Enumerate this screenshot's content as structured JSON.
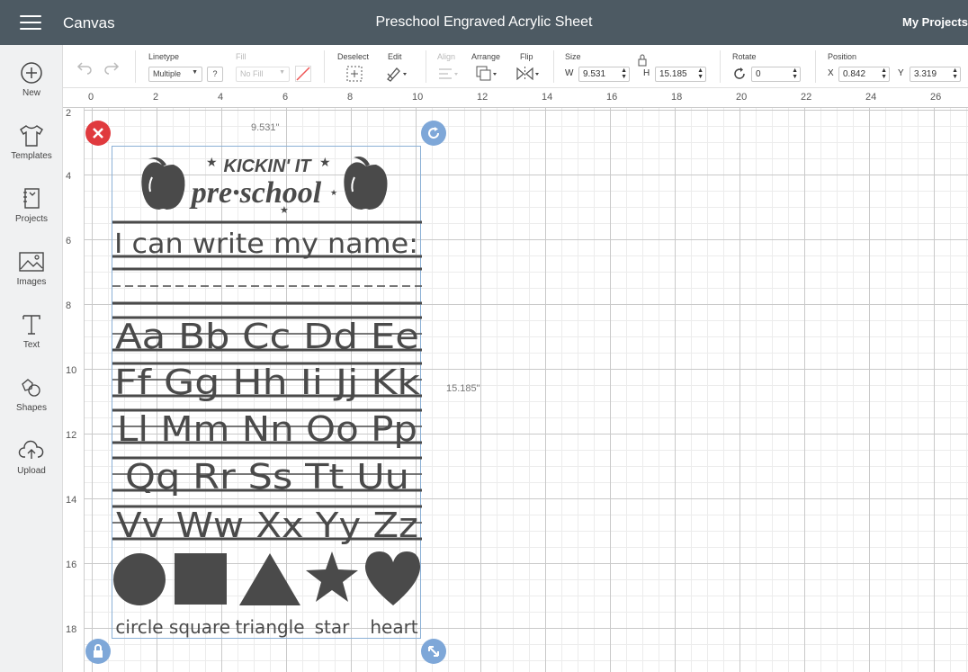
{
  "app": {
    "title": "Canvas",
    "project_title": "Preschool Engraved Acrylic Sheet",
    "my_projects": "My Projects"
  },
  "sidebar": {
    "items": [
      {
        "label": "New",
        "icon": "plus-circle-icon"
      },
      {
        "label": "Templates",
        "icon": "shirt-icon"
      },
      {
        "label": "Projects",
        "icon": "notebook-icon"
      },
      {
        "label": "Images",
        "icon": "image-icon"
      },
      {
        "label": "Text",
        "icon": "text-icon"
      },
      {
        "label": "Shapes",
        "icon": "shapes-icon"
      },
      {
        "label": "Upload",
        "icon": "cloud-upload-icon"
      }
    ]
  },
  "toolbar": {
    "linetype_label": "Linetype",
    "linetype_value": "Multiple",
    "linetype_help": "?",
    "fill_label": "Fill",
    "fill_value": "No Fill",
    "deselect_label": "Deselect",
    "edit_label": "Edit",
    "align_label": "Align",
    "arrange_label": "Arrange",
    "flip_label": "Flip",
    "size_label": "Size",
    "w_label": "W",
    "w_value": "9.531",
    "h_label": "H",
    "h_value": "15.185",
    "rotate_label": "Rotate",
    "rotate_value": "0",
    "position_label": "Position",
    "x_label": "X",
    "x_value": "0.842",
    "y_label": "Y",
    "y_value": "3.319"
  },
  "rulers": {
    "horizontal": [
      "0",
      "2",
      "4",
      "6",
      "8",
      "10",
      "12",
      "14",
      "16",
      "18",
      "20",
      "22",
      "24",
      "26"
    ],
    "vertical": [
      "2",
      "4",
      "6",
      "8",
      "10",
      "12",
      "14",
      "16",
      "18"
    ]
  },
  "design": {
    "width_label": "9.531\"",
    "height_label": "15.185\"",
    "header_line1": "KICKIN' IT",
    "header_line2": "pre·school",
    "name_line": "I can write my name:",
    "alphabet_rows": [
      "Aa Bb Cc Dd Ee",
      "Ff Gg Hh Ii Jj Kk",
      "Ll Mm Nn Oo Pp",
      "Qq Rr Ss Tt Uu",
      "Vv Ww Xx Yy Zz"
    ],
    "shapes": [
      "circle",
      "square",
      "triangle",
      "star",
      "heart"
    ],
    "fill_color": "#4a4a4a"
  },
  "colors": {
    "topbar": "#4d5a63",
    "delete_handle": "#e03a3e",
    "handle_blue": "#7ea7d8"
  }
}
